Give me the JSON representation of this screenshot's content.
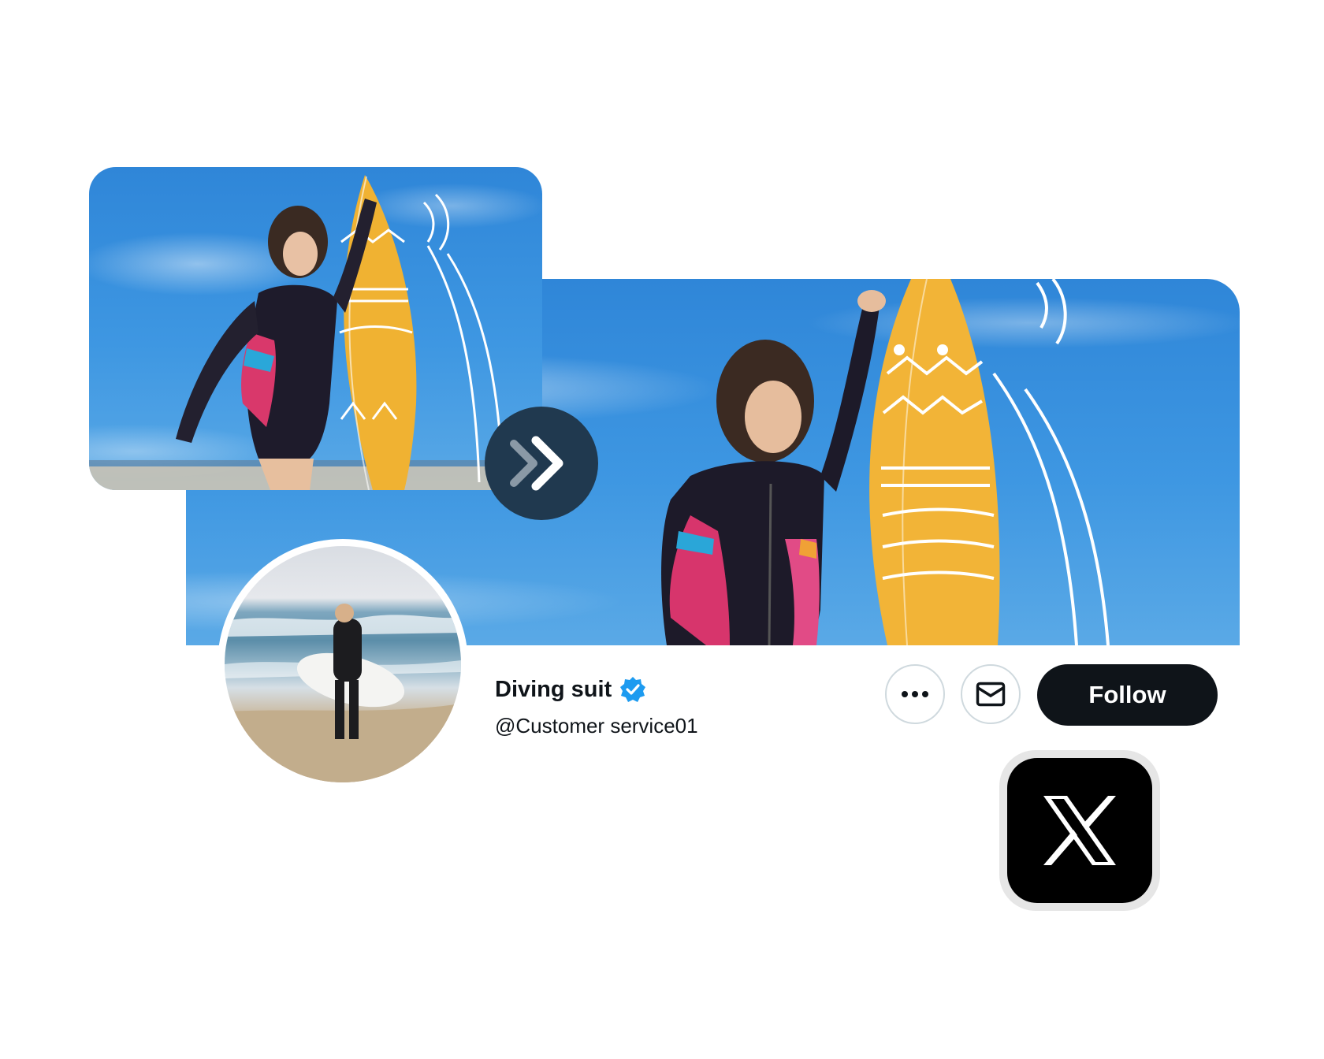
{
  "profile": {
    "display_name": "Diving suit",
    "handle": "@Customer service01",
    "verified": true
  },
  "actions": {
    "follow_label": "Follow",
    "more_icon": "more-horizontal-icon",
    "message_icon": "mail-icon"
  },
  "colors": {
    "follow_bg": "#0f1419",
    "verified_badge": "#1d9bf0",
    "arrow_circle": "#20394f",
    "x_logo_bg": "#000000"
  },
  "brand": {
    "logo": "x-logo-icon"
  }
}
